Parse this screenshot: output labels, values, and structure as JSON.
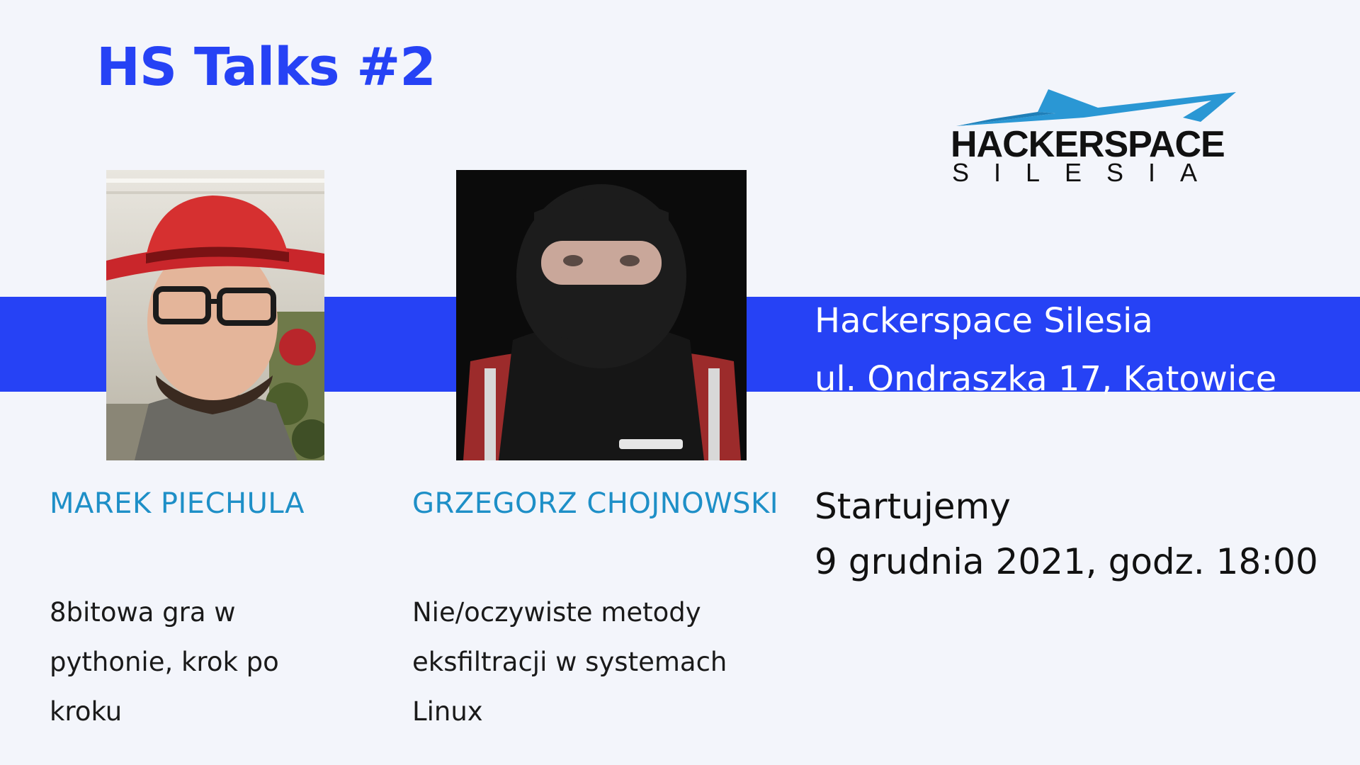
{
  "event": {
    "title": "HS Talks #2"
  },
  "logo": {
    "line1": "HACKERSPACE",
    "line2": "SILESIA"
  },
  "colors": {
    "accent": "#2642f5",
    "speaker_name": "#1e8fc7",
    "background": "#f3f5fb"
  },
  "venue": {
    "name": "Hackerspace Silesia",
    "address": "ul. Ondraszka 17, Katowice"
  },
  "schedule": {
    "label": "Startujemy",
    "datetime": "9 grudnia 2021, godz. 18:00"
  },
  "speakers": [
    {
      "name": "MAREK PIECHULA",
      "talk_lines": [
        "8bitowa gra w",
        "pythonie, krok po",
        "kroku"
      ]
    },
    {
      "name": "GRZEGORZ CHOJNOWSKI",
      "talk_lines": [
        "Nie/oczywiste metody",
        "eksfiltracji w systemach",
        "Linux"
      ]
    }
  ]
}
